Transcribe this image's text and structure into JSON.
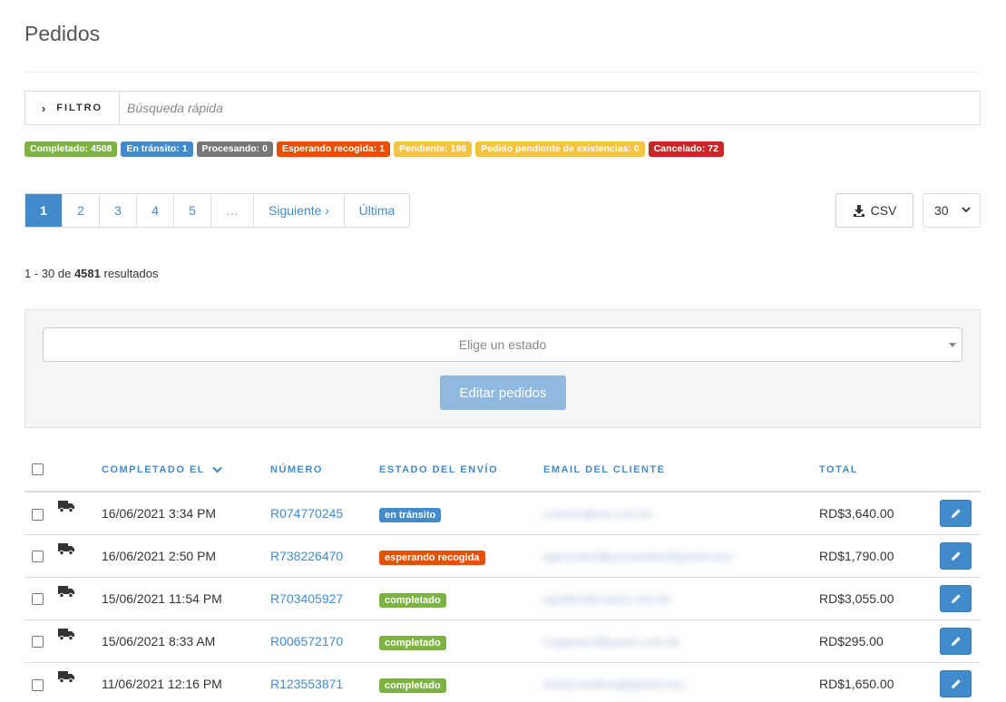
{
  "page": {
    "title": "Pedidos"
  },
  "filter": {
    "button_label": "FILTRO",
    "placeholder": "Búsqueda rápida"
  },
  "status_badges": [
    {
      "label": "Completado: 4508",
      "color": "#7cb342"
    },
    {
      "label": "En tránsito: 1",
      "color": "#428bca"
    },
    {
      "label": "Procesando: 0",
      "color": "#777777"
    },
    {
      "label": "Esperando recogida: 1",
      "color": "#e65100"
    },
    {
      "label": "Pendiente: 196",
      "color": "#f5c342"
    },
    {
      "label": "Pedido pendiente de existencias: 0",
      "color": "#f5c342"
    },
    {
      "label": "Cancelado: 72",
      "color": "#c62828"
    }
  ],
  "pagination": {
    "pages": [
      "1",
      "2",
      "3",
      "4",
      "5",
      "…"
    ],
    "active": "1",
    "next_label": "Siguiente ›",
    "last_label": "Última"
  },
  "toolbar": {
    "csv_label": "CSV",
    "per_page": "30"
  },
  "results": {
    "range": "1 - 30 de",
    "total": "4581",
    "suffix": "resultados"
  },
  "bulk": {
    "select_placeholder": "Elige un estado",
    "edit_button": "Editar pedidos"
  },
  "table": {
    "headers": {
      "completed": "COMPLETADO EL",
      "number": "NÚMERO",
      "shipping_state": "ESTADO DEL ENVÍO",
      "email": "EMAIL DEL CLIENTE",
      "total": "TOTAL"
    },
    "rows": [
      {
        "date": "16/06/2021 3:34 PM",
        "number": "R074770245",
        "status": "en tránsito",
        "status_color": "#428bca",
        "email": "j.ramos@era.com.do",
        "total": "RD$3,640.00"
      },
      {
        "date": "16/06/2021 2:50 PM",
        "number": "R738226470",
        "status": "esperando recogida",
        "status_color": "#e65100",
        "email": "agonzalez@ponsandez@gmail.com",
        "total": "RD$1,790.00"
      },
      {
        "date": "15/06/2021 11:54 PM",
        "number": "R703405927",
        "status": "completado",
        "status_color": "#7cb342",
        "email": "agodino@copao.com.do",
        "total": "RD$3,055.00"
      },
      {
        "date": "15/06/2021 8:33 AM",
        "number": "R006572170",
        "status": "completado",
        "status_color": "#7cb342",
        "email": "magomez@jusoto.com.do",
        "total": "RD$295.00"
      },
      {
        "date": "11/06/2021 12:16 PM",
        "number": "R123553871",
        "status": "completado",
        "status_color": "#7cb342",
        "email": "landyrosellona@gmail.com",
        "total": "RD$1,650.00"
      }
    ]
  }
}
